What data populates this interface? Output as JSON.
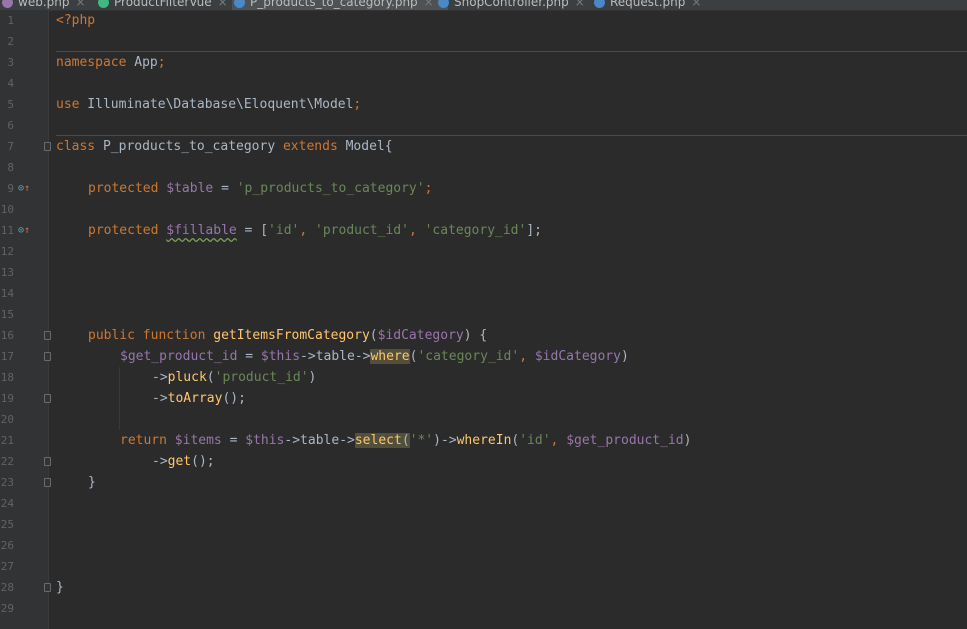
{
  "tabs": [
    {
      "label": "web.php",
      "icon_color": "#9876aa",
      "active": false
    },
    {
      "label": "ProductFilterVue",
      "icon_color": "#41b883",
      "active": false
    },
    {
      "label": "P_products_to_category.php",
      "icon_color": "#4a88c7",
      "active": true
    },
    {
      "label": "ShopController.php",
      "icon_color": "#4a88c7",
      "active": false
    },
    {
      "label": "Request.php",
      "icon_color": "#4a88c7",
      "active": false
    }
  ],
  "tab_close": "×",
  "line_numbers": [
    "1",
    "2",
    "3",
    "4",
    "5",
    "6",
    "7",
    "8",
    "9",
    "10",
    "11",
    "12",
    "13",
    "14",
    "15",
    "16",
    "17",
    "18",
    "19",
    "20",
    "21",
    "22",
    "23",
    "24",
    "25",
    "26",
    "27",
    "28",
    "29"
  ],
  "code": {
    "l1": {
      "open": "<?php"
    },
    "l3": {
      "kw": "namespace",
      "name": " App",
      "semi": ";"
    },
    "l5": {
      "kw": "use",
      "name": " Illuminate\\Database\\Eloquent\\Model",
      "semi": ";"
    },
    "l7": {
      "kw1": "class",
      "name": " P_products_to_category ",
      "kw2": "extends",
      "base": " Model{"
    },
    "l9": {
      "kw": "protected",
      "var": " $table",
      "eq": " = ",
      "str": "'p_products_to_category'",
      "semi": ";"
    },
    "l11": {
      "kw": "protected",
      "sp": " ",
      "var": "$fillable",
      "eq": " = [",
      "s1": "'id'",
      "c1": ", ",
      "s2": "'product_id'",
      "c2": ", ",
      "s3": "'category_id'",
      "end": "];"
    },
    "l16": {
      "kw1": "public",
      "sp": " ",
      "kw2": "function",
      "sp2": " ",
      "fn": "getItemsFromCategory",
      "p1": "(",
      "var": "$idCategory",
      "p2": ") {"
    },
    "l17": {
      "var1": "$get_product_id",
      "eq": " = ",
      "var2": "$this",
      "arrow1": "->",
      "prop": "table",
      "arrow2": "->",
      "fn": "where",
      "p1": "(",
      "str": "'category_id'",
      "comma": ", ",
      "var3": "$idCategory",
      "p2": ")"
    },
    "l18": {
      "arrow": "->",
      "fn": "pluck",
      "p1": "(",
      "str": "'product_id'",
      "p2": ")"
    },
    "l19": {
      "arrow": "->",
      "fn": "toArray",
      "p": "();"
    },
    "l21": {
      "kw": "return",
      "sp": " ",
      "var1": "$items",
      "eq": " = ",
      "var2": "$this",
      "arrow1": "->",
      "prop": "table",
      "arrow2": "->",
      "fn1": "select",
      "p1": "(",
      "str1": "'*'",
      "p2": ")",
      "arrow3": "->",
      "fn2": "whereIn",
      "p3": "(",
      "str2": "'id'",
      "comma": ", ",
      "var3": "$get_product_id",
      "p4": ")"
    },
    "l22": {
      "arrow": "->",
      "fn": "get",
      "p": "();"
    },
    "l23": {
      "brace": "}"
    },
    "l28": {
      "brace": "}"
    }
  },
  "gutter_markers": {
    "override": "⊙",
    "up_arrow": "↑"
  }
}
